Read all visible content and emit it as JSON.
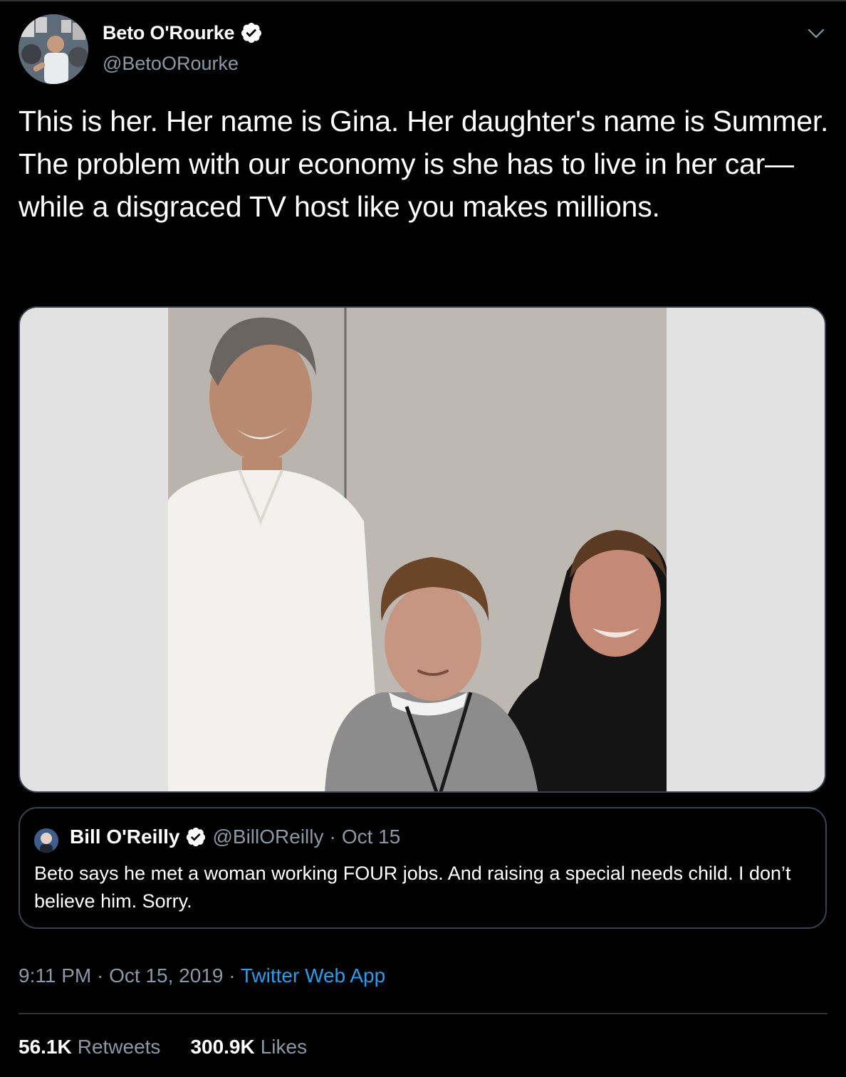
{
  "author": {
    "name": "Beto O'Rourke",
    "handle": "@BetoORourke",
    "verified": true,
    "avatar": "profile-photo"
  },
  "tweet": {
    "text": "This is her. Her name is Gina. Her daughter's name is Summer. The problem with our economy is she has to live in her car—while a disgraced TV host like you makes millions.",
    "media": "photo-three-people-posing"
  },
  "quoted_tweet": {
    "name": "Bill O'Reilly",
    "handle": "@BillOReilly",
    "separator": "·",
    "date": "Oct 15",
    "verified": true,
    "text": "Beto says he met a woman working FOUR jobs. And raising a special needs child. I don’t believe him. Sorry."
  },
  "meta": {
    "time": "9:11 PM",
    "separator1": " · ",
    "date": "Oct 15, 2019",
    "separator2": " · ",
    "source": "Twitter Web App"
  },
  "stats": {
    "retweets_count": "56.1K",
    "retweets_label": "Retweets",
    "likes_count": "300.9K",
    "likes_label": "Likes"
  },
  "icons": {
    "verified": "verified-badge-icon",
    "more": "chevron-down-icon"
  },
  "colors": {
    "background": "#000000",
    "link": "#1da1f2",
    "secondary_text": "#8b98a5",
    "border": "#38444d"
  }
}
